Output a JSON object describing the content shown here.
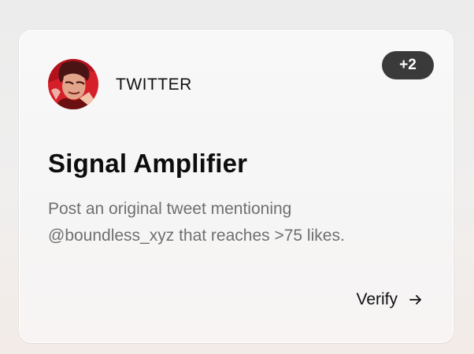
{
  "card": {
    "platform": "TWITTER",
    "badge": "+2",
    "title": "Signal Amplifier",
    "description_line1": "Post an original tweet mentioning",
    "description_line2": "@boundless_xyz that reaches >75 likes.",
    "action_label": "Verify",
    "avatar_icon": "anime-character-avatar",
    "action_icon": "arrow-right-icon"
  },
  "colors": {
    "badge_bg": "#3a3a3a",
    "avatar_red": "#d5202a",
    "text_primary": "#111111",
    "text_secondary": "#6f6f6f"
  }
}
